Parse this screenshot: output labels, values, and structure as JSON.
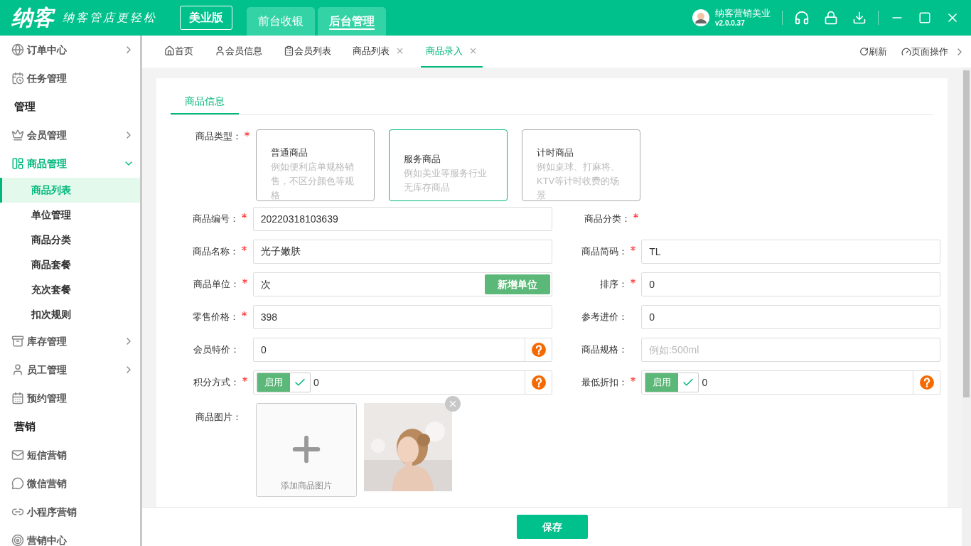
{
  "header": {
    "logo": "纳客",
    "slogan": "纳客管店更轻松",
    "edition": "美业版",
    "top_tabs": [
      {
        "label": "前台收银",
        "selected": false
      },
      {
        "label": "后台管理",
        "selected": true
      }
    ],
    "user": {
      "name": "纳客营销美业",
      "version": "v2.0.0.37"
    }
  },
  "sidebar": {
    "items": [
      {
        "kind": "item",
        "label": "订单中心",
        "expanded": false
      },
      {
        "kind": "item",
        "label": "任务管理"
      },
      {
        "kind": "section",
        "label": "管理"
      },
      {
        "kind": "item",
        "label": "会员管理",
        "expanded": false
      },
      {
        "kind": "item",
        "label": "商品管理",
        "expanded": true,
        "children": [
          {
            "label": "商品列表",
            "selected": true
          },
          {
            "label": "单位管理",
            "selected": false
          },
          {
            "label": "商品分类",
            "selected": false
          },
          {
            "label": "商品套餐",
            "selected": false
          },
          {
            "label": "充次套餐",
            "selected": false
          },
          {
            "label": "扣次规则",
            "selected": false
          }
        ]
      },
      {
        "kind": "item",
        "label": "库存管理",
        "expanded": false
      },
      {
        "kind": "item",
        "label": "员工管理",
        "expanded": false
      },
      {
        "kind": "item",
        "label": "预约管理"
      },
      {
        "kind": "section",
        "label": "营销"
      },
      {
        "kind": "item",
        "label": "短信营销"
      },
      {
        "kind": "item",
        "label": "微信营销"
      },
      {
        "kind": "item",
        "label": "小程序营销"
      },
      {
        "kind": "item",
        "label": "营销中心"
      }
    ]
  },
  "page_tabs": [
    {
      "label": "首页",
      "selected": false,
      "closable": false
    },
    {
      "label": "会员信息",
      "selected": false,
      "closable": false
    },
    {
      "label": "会员列表",
      "selected": false,
      "closable": false
    },
    {
      "label": "商品列表",
      "selected": false,
      "closable": true
    },
    {
      "label": "商品录入",
      "selected": true,
      "closable": true
    }
  ],
  "page_actions": [
    "刷新",
    "页面操作"
  ],
  "form": {
    "tab": "商品信息",
    "type_field": {
      "label": "商品类型：",
      "required": true,
      "options": [
        {
          "title": "普通商品",
          "description": "例如便利店单规格销售，不区分颜色等规格",
          "selected": false
        },
        {
          "title": "服务商品",
          "description": "例如美业等服务行业无库存商品",
          "selected": true
        },
        {
          "title": "计时商品",
          "description": "例如桌球、打麻将、KTV等计时收费的场景",
          "selected": false
        }
      ]
    },
    "rows": [
      [
        {
          "kind": "text",
          "label": "商品编号：",
          "required": true,
          "value": "20220318103639"
        },
        {
          "kind": "none",
          "label": "商品分类：",
          "required": true
        }
      ],
      [
        {
          "kind": "text",
          "label": "商品名称：",
          "required": true,
          "value": "光子嫩肤"
        },
        {
          "kind": "text",
          "label": "商品简码：",
          "required": true,
          "value": "TL"
        }
      ],
      [
        {
          "kind": "unit",
          "label": "商品单位：",
          "required": true,
          "value": "次",
          "button": "新增单位"
        },
        {
          "kind": "text",
          "label": "排序：",
          "required": true,
          "value": "0"
        }
      ],
      [
        {
          "kind": "text",
          "label": "零售价格：",
          "required": true,
          "value": "398"
        },
        {
          "kind": "text",
          "label": "参考进价：",
          "required": false,
          "value": "0"
        }
      ],
      [
        {
          "kind": "help",
          "label": "会员特价：",
          "required": false,
          "value": "0"
        },
        {
          "kind": "text",
          "label": "商品规格：",
          "required": false,
          "placeholder": "例如:500ml"
        }
      ],
      [
        {
          "kind": "toggle",
          "label": "积分方式：",
          "required": true,
          "toggle_label": "启用",
          "checked": true,
          "value": "0"
        },
        {
          "kind": "toggle",
          "label": "最低折扣：",
          "required": true,
          "toggle_label": "启用",
          "checked": true,
          "value": "0"
        }
      ]
    ],
    "image": {
      "label": "商品图片：",
      "add_label": "添加商品图片"
    },
    "save": "保存"
  }
}
